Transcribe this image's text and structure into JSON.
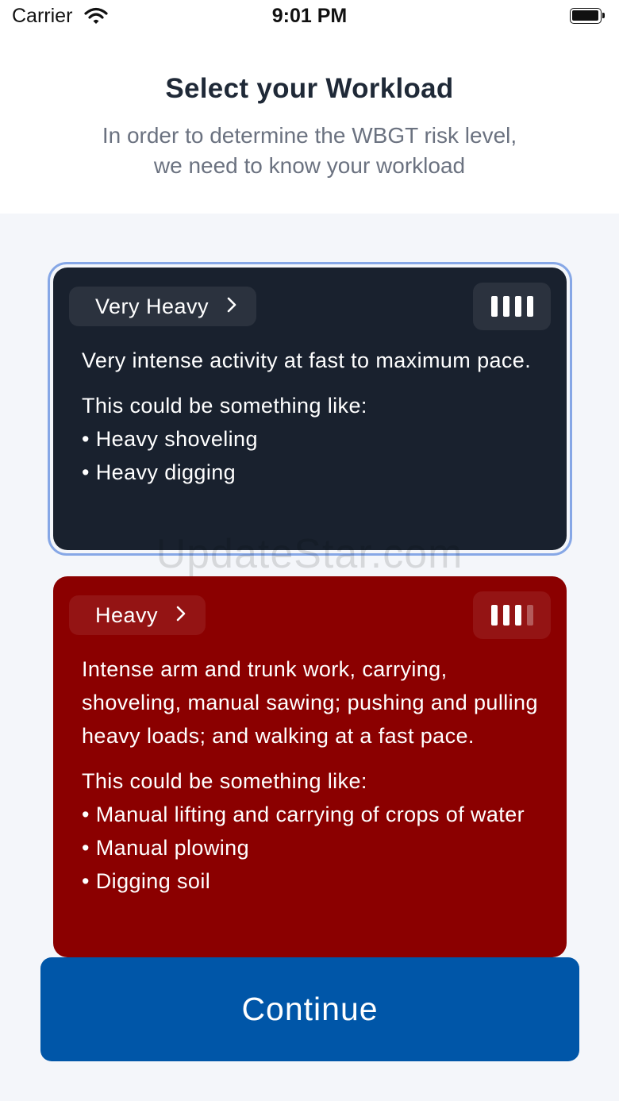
{
  "status_bar": {
    "carrier": "Carrier",
    "time": "9:01 PM",
    "icons": [
      "wifi-icon",
      "battery-icon"
    ]
  },
  "header": {
    "title": "Select your Workload",
    "subtitle_line1": "In order to determine the WBGT risk level,",
    "subtitle_line2": "we need to know your workload"
  },
  "workloads": [
    {
      "label": "Very Heavy",
      "selected": true,
      "intensity_level": 4,
      "intensity_max": 4,
      "color": "#19212e",
      "description": "Very intense activity at fast to maximum pace.",
      "examples_title": "This could be something like:",
      "examples": [
        "Heavy shoveling",
        "Heavy digging"
      ]
    },
    {
      "label": "Heavy",
      "selected": false,
      "intensity_level": 3,
      "intensity_max": 4,
      "color": "#8b0000",
      "description": "Intense arm and trunk work, carrying, shoveling, manual sawing; pushing and pulling heavy loads; and walking at a fast pace.",
      "examples_title": "This could be something like:",
      "examples": [
        "Manual lifting and carrying of crops of water",
        "Manual plowing",
        "Digging soil"
      ]
    }
  ],
  "watermark": "UpdateStar.com",
  "continue_label": "Continue",
  "colors": {
    "accent": "#0056a8",
    "selected_ring": "#86a7e6",
    "background": "#f4f6fa"
  }
}
